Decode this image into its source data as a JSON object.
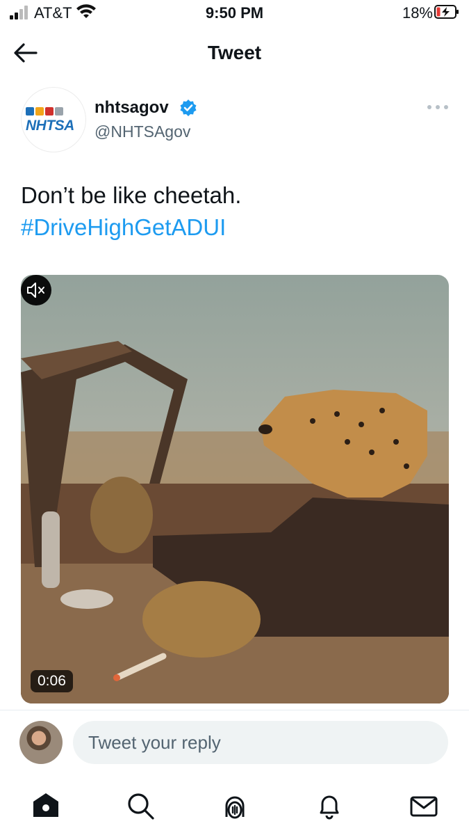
{
  "status_bar": {
    "carrier": "AT&T",
    "time": "9:50 PM",
    "battery_percent": "18%"
  },
  "header": {
    "title": "Tweet"
  },
  "author": {
    "avatar_text": "NHTSA",
    "display_name": "nhtsagov",
    "handle": "@NHTSAgov",
    "verified": true
  },
  "tweet": {
    "text": "Don’t be like cheetah.",
    "hashtag": "#DriveHighGetADUI",
    "media": {
      "type": "video",
      "duration": "0:06",
      "muted": true
    }
  },
  "reply": {
    "placeholder": "Tweet your reply"
  },
  "bottom_nav": {
    "items": [
      "home-icon",
      "search-icon",
      "spaces-icon",
      "notifications-icon",
      "messages-icon"
    ]
  },
  "colors": {
    "accent": "#1d9bf0",
    "nhtsa_blue": "#1d6fb8",
    "secondary_text": "#536471"
  }
}
